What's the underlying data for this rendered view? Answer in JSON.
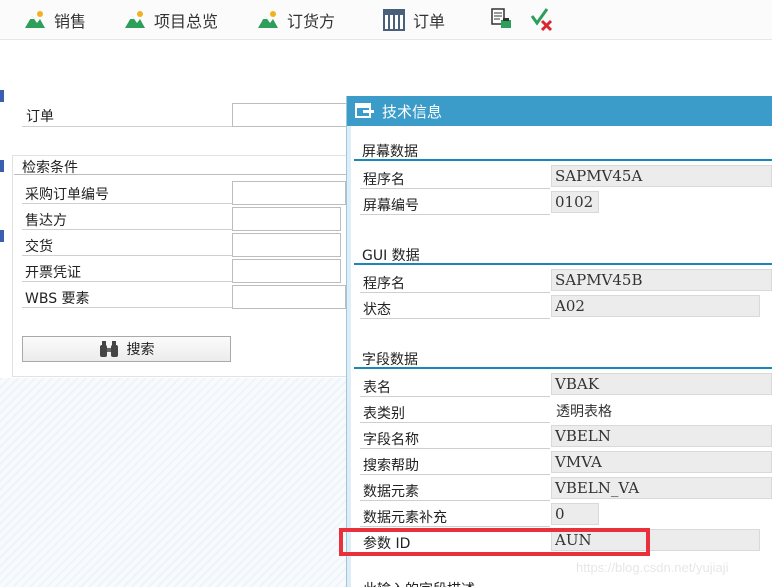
{
  "toolbar": {
    "sales": "销售",
    "project_overview": "项目总览",
    "sold_to_party": "订货方",
    "order": "订单",
    "icons": [
      "mountain-chart-icon",
      "mountain-chart-icon",
      "mountain-chart-icon",
      "table-grid-icon",
      "document-copy-icon",
      "check-cancel-icon"
    ]
  },
  "form": {
    "order_label": "订单",
    "criteria_title": "检索条件",
    "fields": [
      "采购订单编号",
      "售达方",
      "交货",
      "开票凭证",
      "WBS 要素"
    ],
    "search_button": "搜索"
  },
  "dialog": {
    "title": "技术信息",
    "screen_section": "屏幕数据",
    "screen_rows": [
      {
        "label": "程序名",
        "value": "SAPMV45A"
      },
      {
        "label": "屏幕编号",
        "value": "0102"
      }
    ],
    "gui_section": "GUI 数据",
    "gui_rows": [
      {
        "label": "程序名",
        "value": "SAPMV45B"
      },
      {
        "label": "状态",
        "value": "A02"
      }
    ],
    "field_section": "字段数据",
    "field_rows": [
      {
        "label": "表名",
        "value": "VBAK"
      },
      {
        "label": "表类别",
        "value": "透明表格"
      },
      {
        "label": "字段名称",
        "value": "VBELN"
      },
      {
        "label": "搜索帮助",
        "value": "VMVA"
      },
      {
        "label": "数据元素",
        "value": "VBELN_VA"
      },
      {
        "label": "数据元素补充",
        "value": "0"
      },
      {
        "label": "参数 ID",
        "value": "AUN"
      }
    ],
    "next_section_partial": "此输入的字段描述"
  },
  "colors": {
    "dialog_title_bg": "#3c9cc9",
    "section_line": "#1a87b8",
    "highlight": "#e8313a"
  },
  "watermark": "https://blog.csdn.net/yujiaji"
}
